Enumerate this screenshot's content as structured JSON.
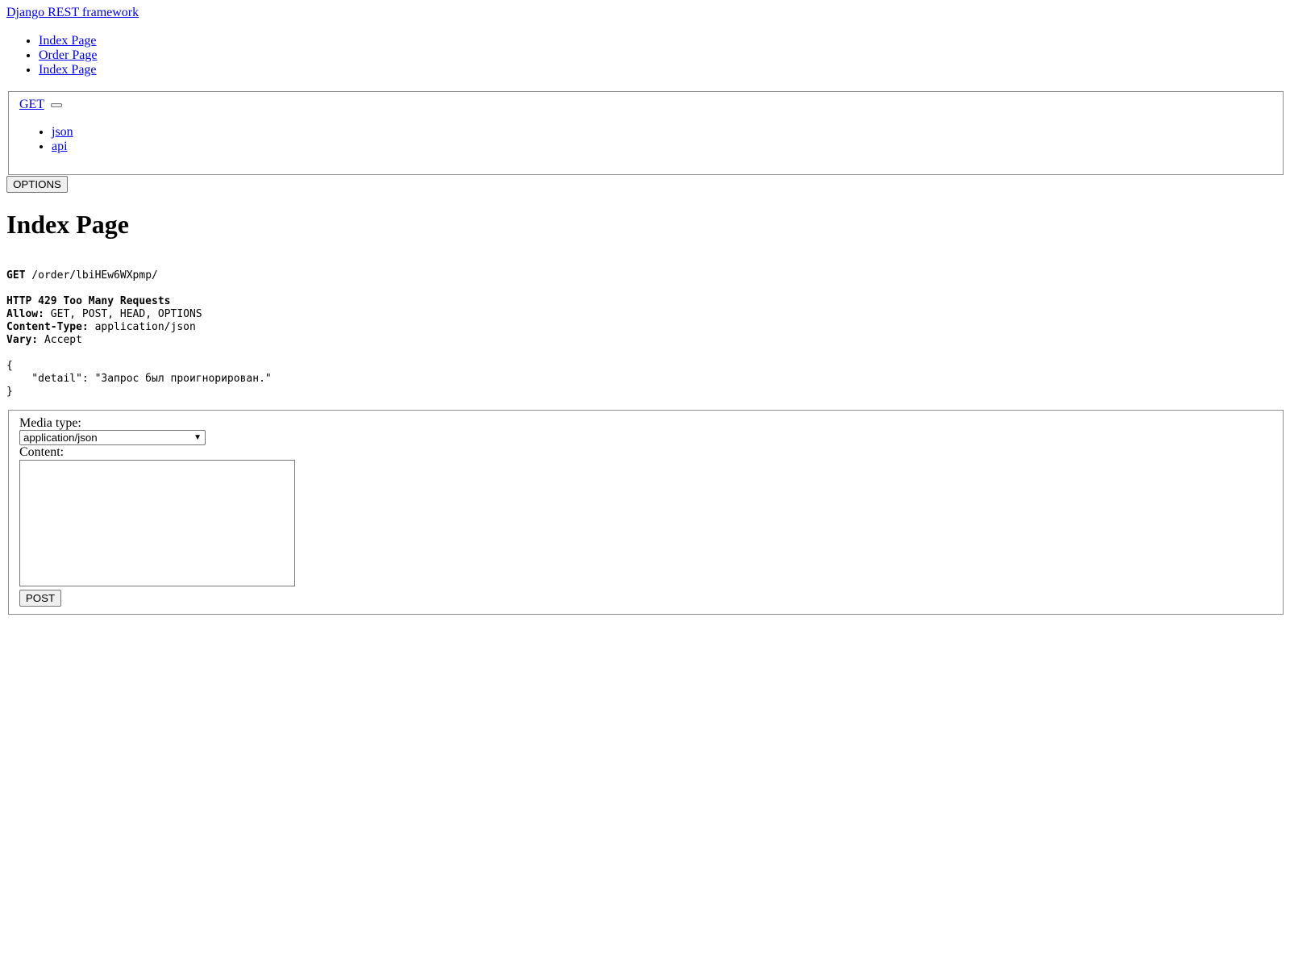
{
  "header": {
    "brand": "Django REST framework"
  },
  "breadcrumbs": [
    "Index Page",
    "Order Page",
    "Index Page"
  ],
  "get_menu": {
    "label": "GET",
    "formats": [
      "json",
      "api"
    ]
  },
  "options_button": "OPTIONS",
  "page_title": "Index Page",
  "request": {
    "method": "GET",
    "path": " /order/lbiHEw6WXpmp/"
  },
  "response": {
    "status": "HTTP 429 Too Many Requests",
    "headers": [
      {
        "name": "Allow:",
        "value": " GET, POST, HEAD, OPTIONS"
      },
      {
        "name": "Content-Type:",
        "value": " application/json"
      },
      {
        "name": "Vary:",
        "value": " Accept"
      }
    ],
    "body_open": "{",
    "body_line": "    \"detail\": \"Запрос был проигнорирован.\"",
    "body_close": "}"
  },
  "post_form": {
    "media_type_label": "Media type:",
    "media_type_value": "application/json",
    "content_label": "Content:",
    "content_value": "",
    "submit_label": "POST"
  }
}
